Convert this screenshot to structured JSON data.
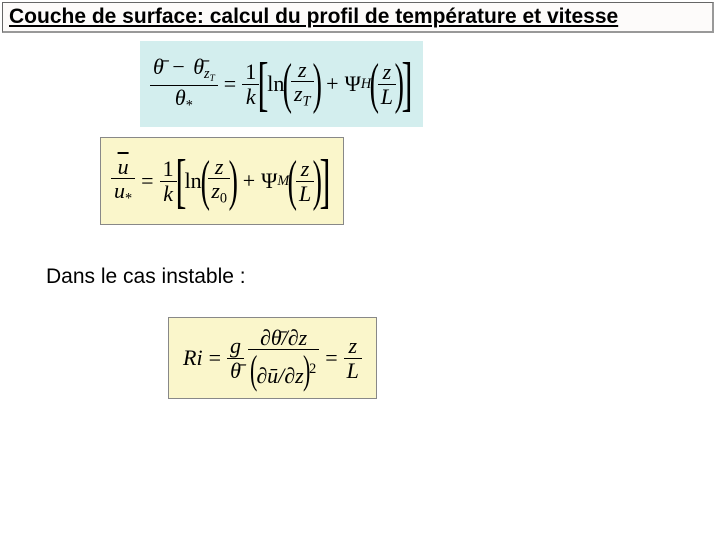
{
  "title": "Couche de surface: calcul du profil de température et vitesse",
  "subtitle": "Dans le cas instable :",
  "sym": {
    "theta_bar": "θ̄",
    "theta_bar_zT": "θ̄",
    "zT_sub": "z",
    "T_sub": "T",
    "theta_star": "θ",
    "star": "*",
    "one_over_k_num": "1",
    "one_over_k_den": "k",
    "ln": "ln",
    "z": "z",
    "z0": "z",
    "zero": "0",
    "PsiH": "Ψ",
    "H": "H",
    "PsiM": "Ψ",
    "M": "M",
    "L": "L",
    "u_bar": "u",
    "u_star": "u",
    "plus": "+",
    "eq": "=",
    "minus": "−",
    "Ri": "Ri",
    "g": "g",
    "dtheta_dz_num": "∂θ̄/∂z",
    "du_dz": "∂ū/∂z",
    "sq": "2"
  }
}
